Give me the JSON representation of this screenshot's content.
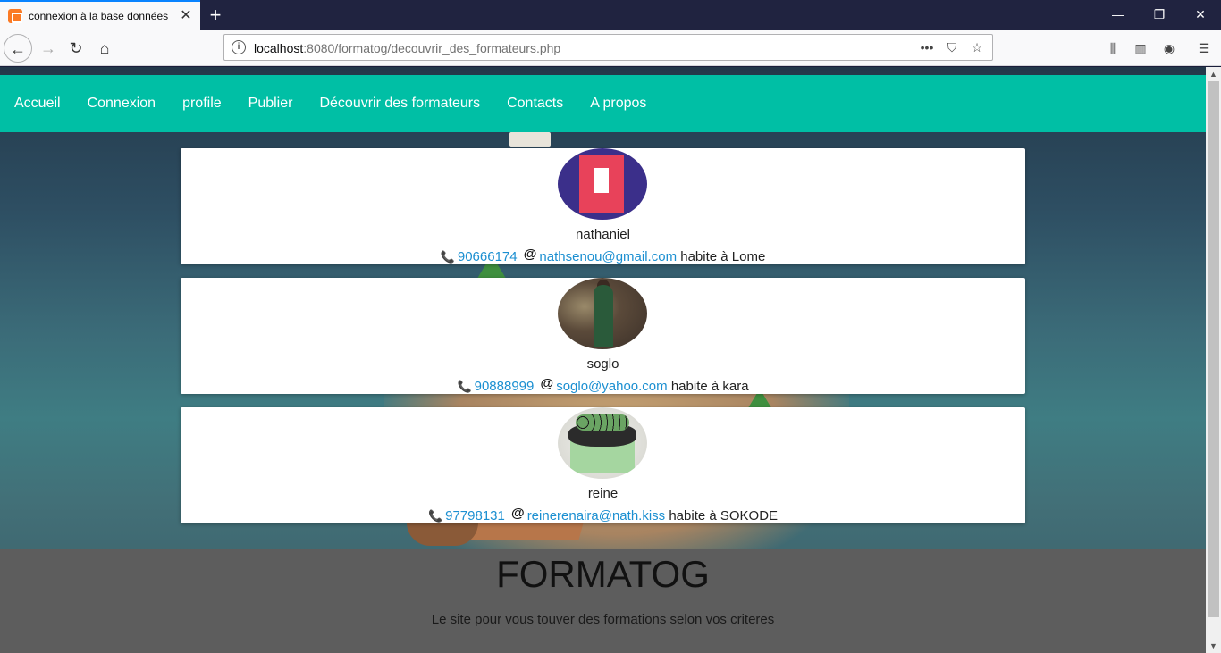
{
  "browser": {
    "tab_title": "connexion à la base données",
    "url_host": "localhost",
    "url_rest": ":8080/formatog/decouvrir_des_formateurs.php"
  },
  "nav": {
    "items": [
      "Accueil",
      "Connexion",
      "profile",
      "Publier",
      "Découvrir des formateurs",
      "Contacts",
      "A propos"
    ]
  },
  "formateurs": [
    {
      "name": "nathaniel",
      "phone": "90666174",
      "email": "nathsenou@gmail.com",
      "lives": "habite à Lome"
    },
    {
      "name": "soglo",
      "phone": "90888999",
      "email": "soglo@yahoo.com",
      "lives": "habite à kara"
    },
    {
      "name": "reine",
      "phone": "97798131",
      "email": "reinerenaira@nath.kiss",
      "lives": "habite à SOKODE"
    }
  ],
  "footer": {
    "title": "FORMATOG",
    "subtitle": "Le site pour vous touver des formations selon vos criteres"
  },
  "colors": {
    "nav_bg": "#00bfa5",
    "link": "#1b8fd1",
    "footer_bg": "#5d5d5d"
  }
}
